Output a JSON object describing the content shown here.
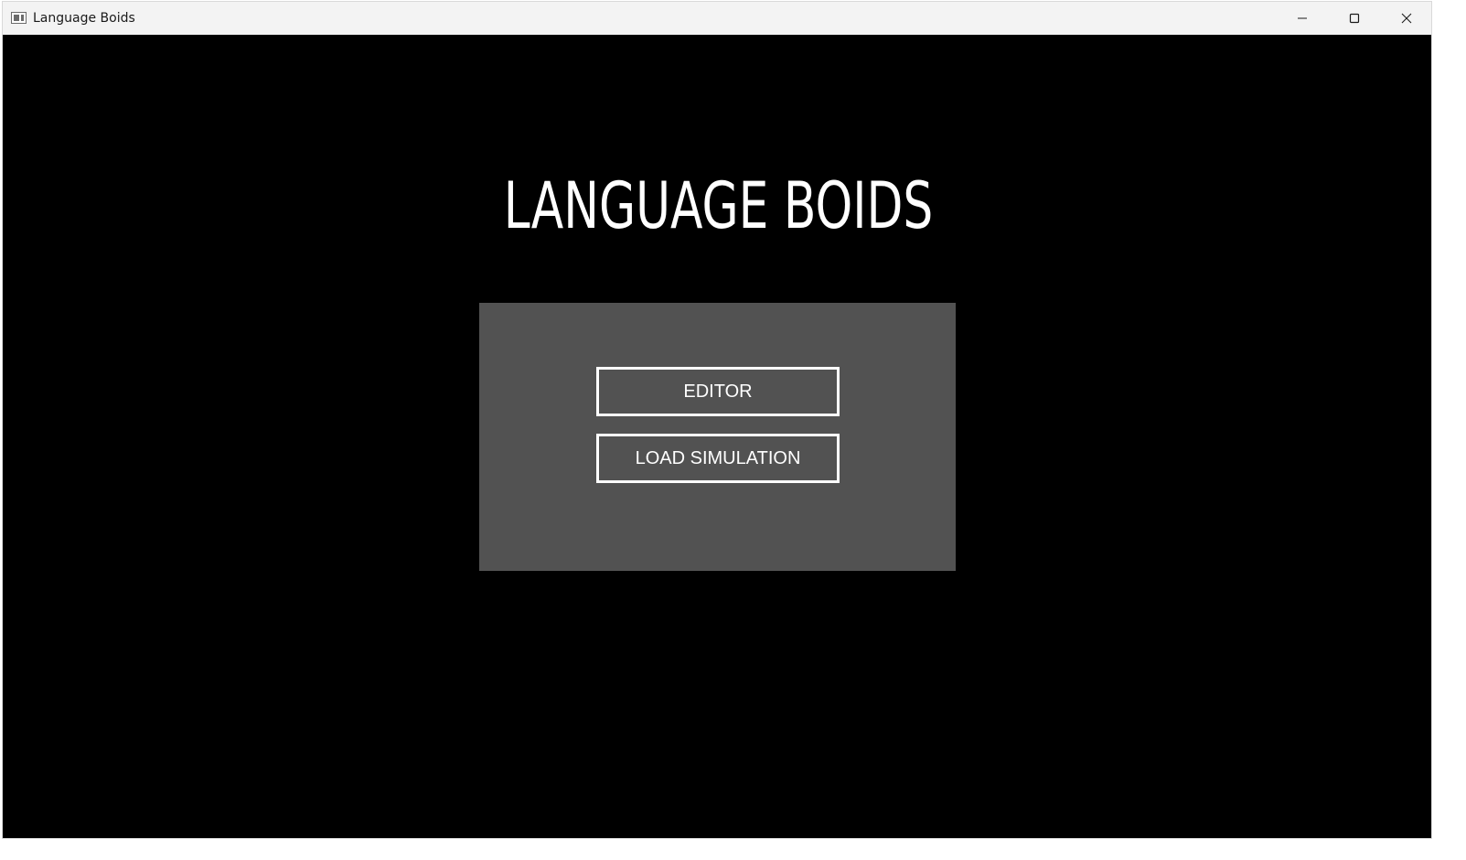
{
  "window": {
    "title": "Language Boids",
    "icon": "app-window-icon",
    "controls": {
      "minimize_icon": "minimize-icon",
      "maximize_icon": "maximize-icon",
      "close_icon": "close-icon"
    }
  },
  "main": {
    "title": "LANGUAGE BOIDS",
    "buttons": {
      "editor_label": "EDITOR",
      "load_simulation_label": "LOAD SIMULATION"
    }
  },
  "colors": {
    "background": "#000000",
    "panel": "#525252",
    "text": "#ffffff",
    "titlebar": "#f3f3f3"
  }
}
